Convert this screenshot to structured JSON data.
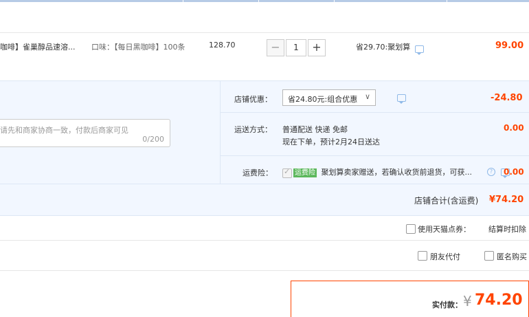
{
  "item": {
    "title": "咖啡】雀巢醇品速溶...",
    "attr": "口味：【每日黑咖啡】100条",
    "unit_price": "128.70",
    "quantity": "1",
    "minus": "−",
    "plus": "+",
    "promo": "省29.70:聚划算",
    "subtotal": "99.00"
  },
  "shop": {
    "discount_label": "店铺优惠：",
    "discount_option": "省24.80元:组合优惠",
    "discount_value": "-24.80",
    "shipping_label": "运送方式：",
    "shipping_method": "普通配送 快递 免邮",
    "shipping_eta": "现在下单，预计2月24日送达",
    "shipping_value": "0.00",
    "insurance_label": "运费险：",
    "insurance_badge": "运费险",
    "insurance_desc": "聚划算卖家赠送，若确认收货前退货，可获...",
    "insurance_value": "0.00",
    "message_placeholder": "请先和商家协商一致，付款后商家可见",
    "message_count": "0/200",
    "total_label": "店铺合计(含运费)",
    "total_value": "¥74.20"
  },
  "options": {
    "points_label": "使用天猫点券：",
    "points_note": "结算时扣除",
    "friend_pay": "朋友代付",
    "anonymous": "匿名购买"
  },
  "payment": {
    "label": "实付款：",
    "currency": "¥",
    "amount": "74.20"
  },
  "colors": {
    "accent_red": "#ff4400",
    "panel_blue": "#f2f7ff"
  }
}
